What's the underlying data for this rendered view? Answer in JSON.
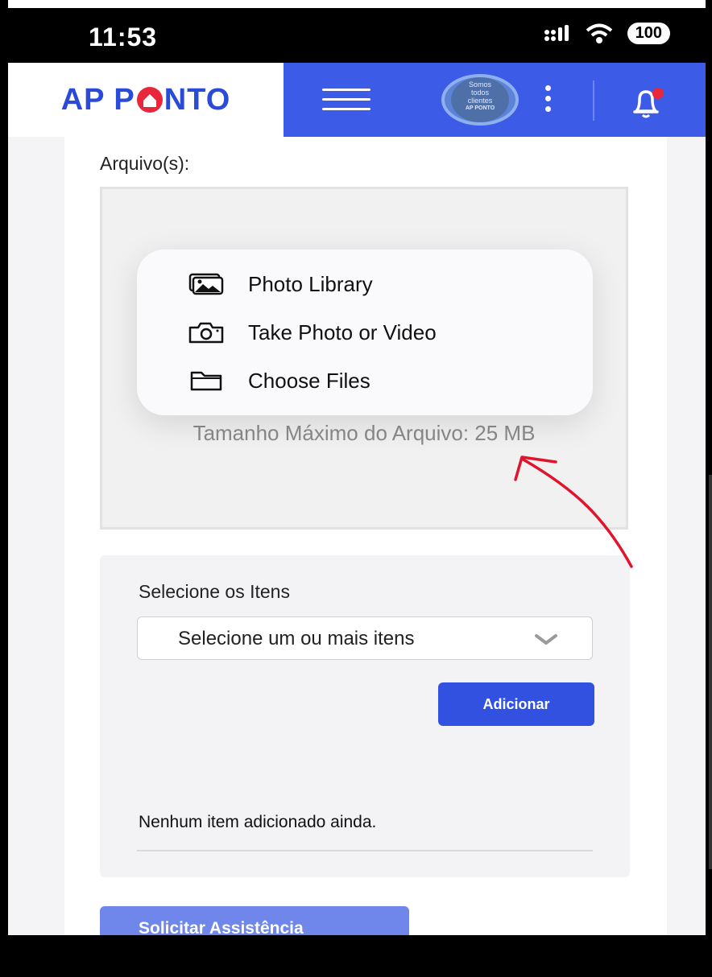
{
  "status_bar": {
    "time": "11:53",
    "battery": "100"
  },
  "header": {
    "logo_text_left": "AP P",
    "logo_text_right": "NTO",
    "avatar_text": [
      "Somos",
      "todos",
      "clientes",
      "AP PONTO"
    ],
    "colors": {
      "brand_blue": "#3c5be6",
      "logo_blue": "#2a4bd7",
      "notification_dot": "#e8273d"
    }
  },
  "files": {
    "label": "Arquivo(s):",
    "max_size_text": "Tamanho Máximo do Arquivo: 25 MB"
  },
  "popup": {
    "items": [
      {
        "label": "Photo Library",
        "icon": "photo-library-icon"
      },
      {
        "label": "Take Photo or Video",
        "icon": "camera-icon"
      },
      {
        "label": "Choose Files",
        "icon": "folder-icon"
      }
    ]
  },
  "items_panel": {
    "title": "Selecione os Itens",
    "select_placeholder": "Selecione um ou mais itens",
    "add_button": "Adicionar",
    "empty_text": "Nenhum item adicionado ainda."
  },
  "submit_button": "Solicitar Assistência"
}
